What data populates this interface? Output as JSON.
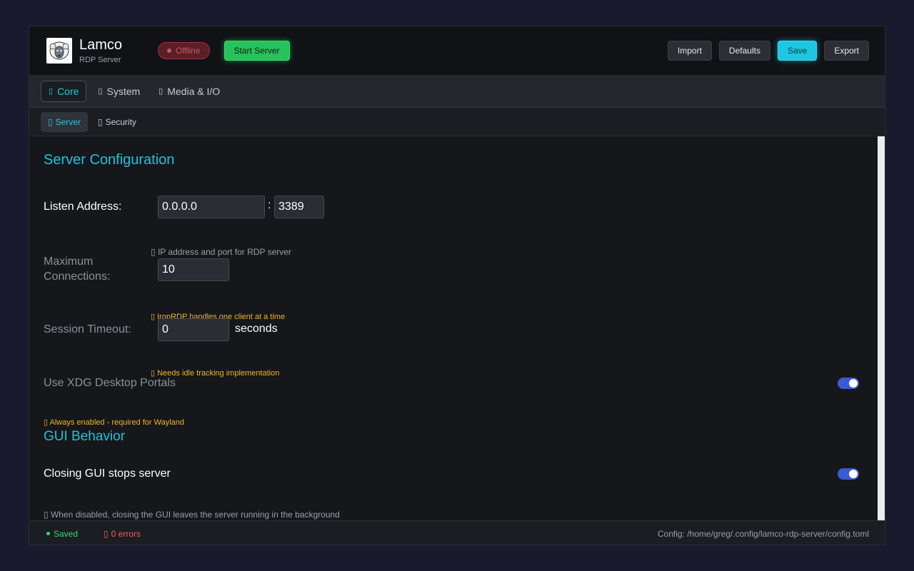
{
  "header": {
    "app_name": "Lamco",
    "app_subtitle": "RDP Server",
    "status": "Offline",
    "start_label": "Start Server",
    "actions": [
      "Import",
      "Defaults",
      "Save",
      "Export"
    ]
  },
  "tabs": [
    {
      "icon": "▯",
      "label": "Core"
    },
    {
      "icon": "▯",
      "label": "System"
    },
    {
      "icon": "▯",
      "label": "Media & I/O"
    }
  ],
  "subtabs": [
    {
      "icon": "▯",
      "label": "Server"
    },
    {
      "icon": "▯",
      "label": "Security"
    }
  ],
  "server": {
    "section_title": "Server Configuration",
    "listen": {
      "label": "Listen Address:",
      "address": "0.0.0.0",
      "separator": ":",
      "port": "3389",
      "hint": "▯ IP address and port for RDP server"
    },
    "max_conn": {
      "label_line1": "Maximum",
      "label_line2": "Connections:",
      "value": "10",
      "hint": "▯ IronRDP handles one client at a time"
    },
    "timeout": {
      "label": "Session Timeout:",
      "value": "0",
      "unit": "seconds",
      "hint": "▯ Needs idle tracking implementation"
    },
    "xdg": {
      "label": "Use XDG Desktop Portals",
      "hint": "▯ Always enabled - required for Wayland",
      "enabled": true
    }
  },
  "gui": {
    "section_title": "GUI Behavior",
    "close_stops": {
      "label": "Closing GUI stops server",
      "hint": "▯ When disabled, closing the GUI leaves the server running in the background",
      "enabled": true
    }
  },
  "footer": {
    "saved": "Saved",
    "errors_icon": "▯",
    "errors": "0 errors",
    "config_path": "Config: /home/greg/.config/lamco-rdp-server/config.toml"
  },
  "colors": {
    "accent": "#1fc2dc",
    "start_green": "#27c25b",
    "offline_red": "#c45a63",
    "warning": "#f0b429",
    "toggle_on": "#3a5bd6"
  }
}
